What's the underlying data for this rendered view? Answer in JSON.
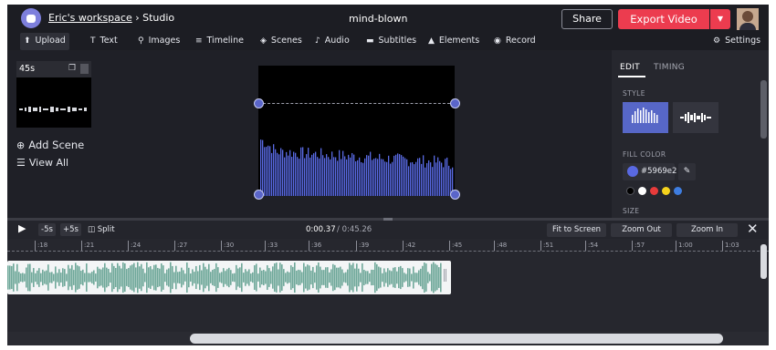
{
  "header": {
    "workspace": "Eric's workspace",
    "separator": "›",
    "section": "Studio",
    "project_title": "mind-blown",
    "share_label": "Share",
    "export_label": "Export Video",
    "export_caret": "▼"
  },
  "toolbar": {
    "items": [
      {
        "label": "Upload",
        "icon": "upload-icon",
        "glyph": "⬆"
      },
      {
        "label": "Text",
        "icon": "text-icon",
        "glyph": "T"
      },
      {
        "label": "Images",
        "icon": "search-icon",
        "glyph": "⚲"
      },
      {
        "label": "Timeline",
        "icon": "timeline-icon",
        "glyph": "≡"
      },
      {
        "label": "Scenes",
        "icon": "layers-icon",
        "glyph": "◈"
      },
      {
        "label": "Audio",
        "icon": "music-note-icon",
        "glyph": "♪"
      },
      {
        "label": "Subtitles",
        "icon": "subtitles-icon",
        "glyph": "▬"
      },
      {
        "label": "Elements",
        "icon": "shapes-icon",
        "glyph": "▲"
      },
      {
        "label": "Record",
        "icon": "record-icon",
        "glyph": "◉"
      }
    ],
    "settings_label": "Settings",
    "settings_glyph": "⚙"
  },
  "scenes": {
    "duration": "45s",
    "copy_glyph": "❐",
    "add_scene_label": "Add Scene",
    "add_scene_glyph": "⊕",
    "view_all_label": "View All",
    "view_all_glyph": "☰"
  },
  "panel": {
    "tabs": [
      "EDIT",
      "TIMING"
    ],
    "active_tab": "EDIT",
    "style_label": "STYLE",
    "fill_color_label": "FILL COLOR",
    "fill_color_value": "#5969e2",
    "picker_glyph": "✎",
    "size_label": "SIZE",
    "swatches": [
      "#000000",
      "#ffffff",
      "#e83b3b",
      "#f5d31d",
      "#3e7de0"
    ]
  },
  "timeline": {
    "play_glyph": "▶",
    "back_label": "-5s",
    "fwd_label": "+5s",
    "split_label": "Split",
    "split_glyph": "◫",
    "current_time": "0:00.37",
    "total_time": "/ 0:45.26",
    "fit_label": "Fit to Screen",
    "zoom_out_label": "Zoom Out",
    "zoom_in_label": "Zoom In",
    "close_glyph": "✕",
    "ticks": [
      ":18",
      ":21",
      ":24",
      ":27",
      ":30",
      ":33",
      ":36",
      ":39",
      ":42",
      ":45",
      ":48",
      ":51",
      ":54",
      ":57",
      "1:00",
      "1:03"
    ]
  },
  "colors": {
    "accent": "#5969e2",
    "export": "#ec3c4f",
    "audio_clip": "#6fa89a",
    "audio_clip_bg": "#f3f5f6"
  }
}
